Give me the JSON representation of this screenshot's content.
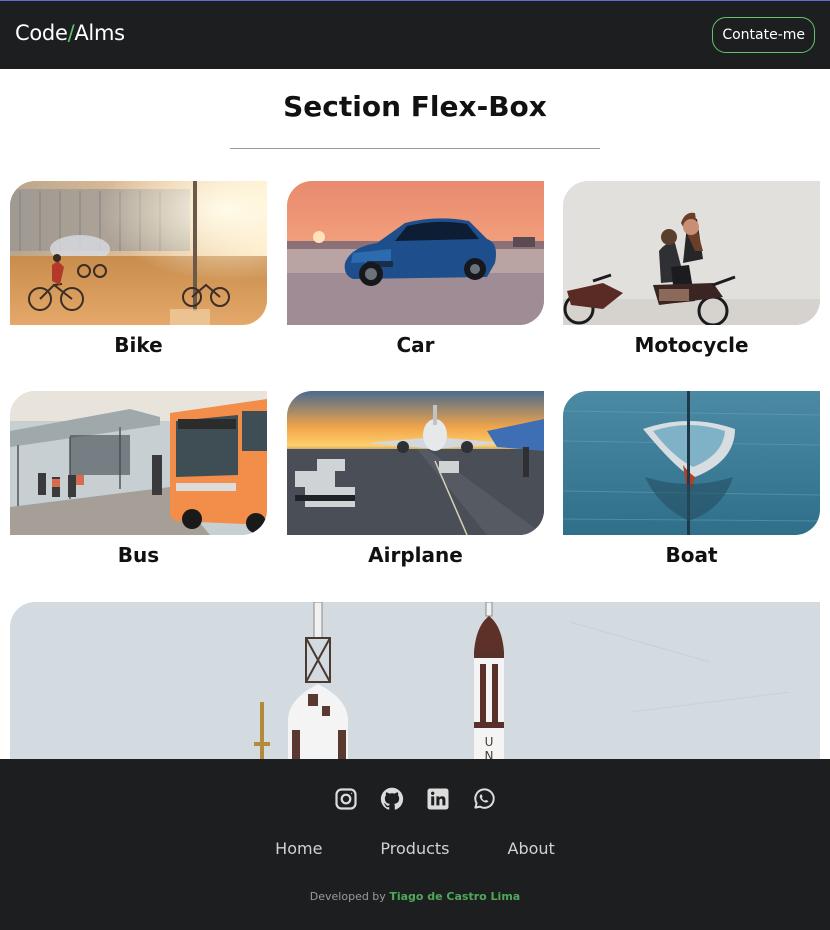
{
  "header": {
    "logo_left": "Code",
    "logo_slash": "/",
    "logo_right": "Alms",
    "contact_label": "Contate-me"
  },
  "section": {
    "title": "Section Flex-Box"
  },
  "cards": [
    {
      "label": "Bike"
    },
    {
      "label": "Car"
    },
    {
      "label": "Motocycle"
    },
    {
      "label": "Bus"
    },
    {
      "label": "Airplane"
    },
    {
      "label": "Boat"
    }
  ],
  "footer": {
    "socials": [
      "instagram-icon",
      "github-icon",
      "linkedin-icon",
      "whatsapp-icon"
    ],
    "nav": [
      "Home",
      "Products",
      "About"
    ],
    "credits_prefix": "Developed by",
    "credits_author": "Tiago de Castro Lima"
  },
  "colors": {
    "header_bg": "#1d1e20",
    "accent": "#5fc46c",
    "author": "#4fa85a"
  }
}
